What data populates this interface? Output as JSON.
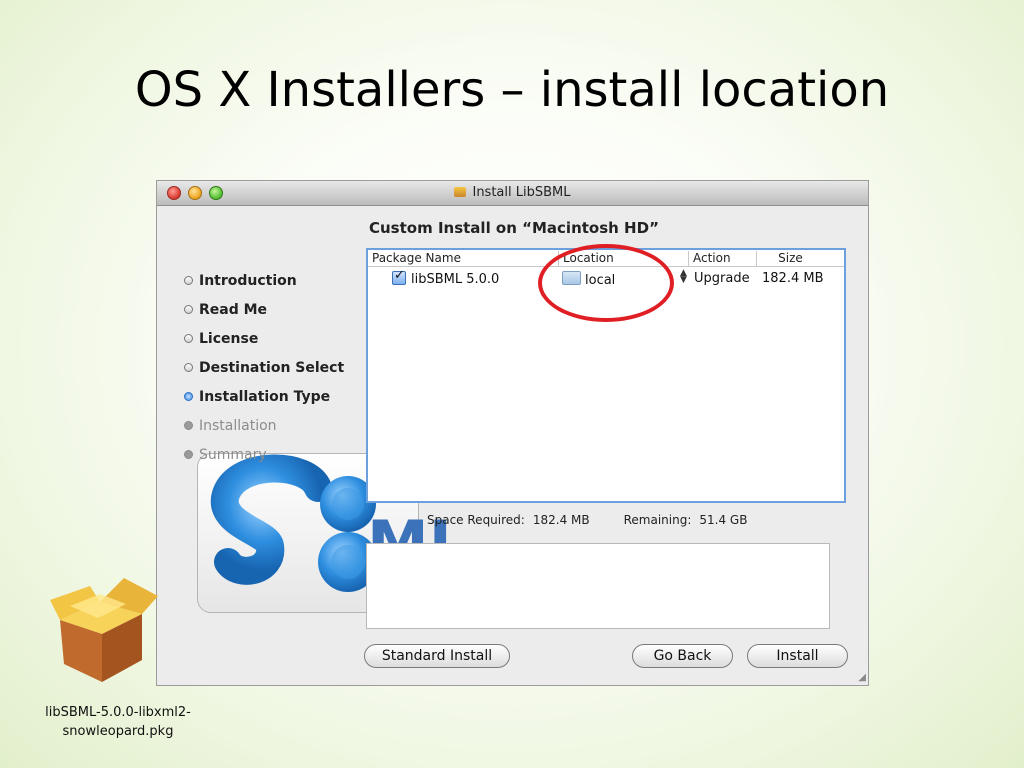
{
  "slide": {
    "title": "OS X Installers – install location"
  },
  "window": {
    "title": "Install LibSBML",
    "heading": "Custom Install on “Macintosh HD”",
    "steps": [
      {
        "label": "Introduction",
        "state": "done"
      },
      {
        "label": "Read Me",
        "state": "done"
      },
      {
        "label": "License",
        "state": "done"
      },
      {
        "label": "Destination Select",
        "state": "done"
      },
      {
        "label": "Installation Type",
        "state": "current"
      },
      {
        "label": "Installation",
        "state": "pending"
      },
      {
        "label": "Summary",
        "state": "pending"
      }
    ],
    "table": {
      "columns": [
        "Package Name",
        "Location",
        "Action",
        "Size"
      ],
      "rows": [
        {
          "package": "libSBML 5.0.0",
          "checked": true,
          "location": "local",
          "action": "Upgrade",
          "size": "182.4 MB"
        }
      ]
    },
    "space_required_label": "Space Required:",
    "space_required": "182.4 MB",
    "remaining_label": "Remaining:",
    "remaining": "51.4 GB",
    "buttons": {
      "standard_install": "Standard Install",
      "go_back": "Go Back",
      "install": "Install"
    },
    "accent_color": "#6ca0dc",
    "highlight_color": "#e01f25"
  },
  "package_file": {
    "line1": "libSBML-5.0.0-libxml2-",
    "line2": "snowleopard.pkg"
  }
}
